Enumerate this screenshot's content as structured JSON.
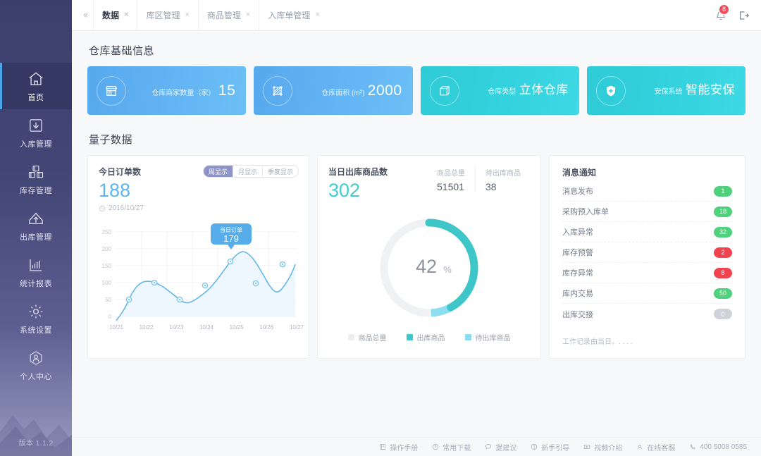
{
  "sidebar": {
    "version": "版本 1.1.2",
    "items": [
      {
        "label": "首页",
        "icon": "home-icon",
        "active": true
      },
      {
        "label": "入库管理",
        "icon": "inbound-arrow-icon",
        "active": false
      },
      {
        "label": "库存管理",
        "icon": "boxes-icon",
        "active": false
      },
      {
        "label": "出库管理",
        "icon": "outbound-arrow-icon",
        "active": false
      },
      {
        "label": "统计报表",
        "icon": "bar-chart-icon",
        "active": false
      },
      {
        "label": "系统设置",
        "icon": "gear-icon",
        "active": false
      },
      {
        "label": "个人中心",
        "icon": "user-hex-icon",
        "active": false
      }
    ]
  },
  "tabbar": {
    "collapse_icon": "collapse-left-icon",
    "tabs": [
      {
        "label": "数据",
        "active": true,
        "close": "×"
      },
      {
        "label": "库区管理",
        "active": false,
        "close": "×"
      },
      {
        "label": "商品管理",
        "active": false,
        "close": "×"
      },
      {
        "label": "入库单管理",
        "active": false,
        "close": "×"
      }
    ],
    "notification_icon": "bell-icon",
    "notification_count": "8",
    "logout_icon": "logout-icon"
  },
  "basic_info": {
    "title": "仓库基础信息",
    "cards": [
      {
        "label": "仓库商家数量（家）",
        "value": "15",
        "icon": "store-icon",
        "theme": "blue",
        "is_word": false
      },
      {
        "label": "仓库面积 (m²)",
        "value": "2000",
        "icon": "area-hatch-icon",
        "theme": "blue",
        "is_word": false
      },
      {
        "label": "仓库类型",
        "value": "立体仓库",
        "icon": "cube-icon",
        "theme": "cyan",
        "is_word": true
      },
      {
        "label": "安保系统",
        "value": "智能安保",
        "icon": "shield-icon",
        "theme": "cyan",
        "is_word": true
      }
    ]
  },
  "quantum": {
    "title": "量子数据",
    "orders_panel": {
      "title": "今日订单数",
      "value": "188",
      "date": "2016/10/27",
      "clock_icon": "clock-icon",
      "segments": [
        {
          "label": "周显示",
          "active": true
        },
        {
          "label": "月显示",
          "active": false
        },
        {
          "label": "季度显示",
          "active": false
        }
      ],
      "tooltip": {
        "title": "当日订单",
        "value": "179"
      }
    },
    "outbound_panel": {
      "title": "当日出库商品数",
      "value": "302",
      "stats": [
        {
          "label": "商品总量",
          "value": "51501"
        },
        {
          "label": "待出库商品",
          "value": "38"
        }
      ],
      "donut_center": "42",
      "donut_unit": "%",
      "legend": [
        {
          "label": "商品总量",
          "color": "#eceef0"
        },
        {
          "label": "出库商品",
          "color": "#3ec6c8"
        },
        {
          "label": "待出库商品",
          "color": "#8ddcf0"
        }
      ]
    },
    "notifications": {
      "title": "消息通知",
      "items": [
        {
          "label": "消息发布",
          "count": "1",
          "type": "green"
        },
        {
          "label": "采购预入库单",
          "count": "18",
          "type": "green"
        },
        {
          "label": "入库异常",
          "count": "32",
          "type": "green"
        },
        {
          "label": "库存预警",
          "count": "2",
          "type": "red"
        },
        {
          "label": "库存异常",
          "count": "8",
          "type": "red"
        },
        {
          "label": "库内交易",
          "count": "50",
          "type": "green"
        },
        {
          "label": "出库交接",
          "count": "0",
          "type": "grey"
        }
      ],
      "footnote": "工作记录由当日。. . . ."
    }
  },
  "footer": {
    "items": [
      {
        "label": "操作手册",
        "icon": "book-icon"
      },
      {
        "label": "常用下载",
        "icon": "download-icon"
      },
      {
        "label": "提建议",
        "icon": "comment-icon"
      },
      {
        "label": "新手引导",
        "icon": "question-icon"
      },
      {
        "label": "视频介绍",
        "icon": "video-icon"
      },
      {
        "label": "在线客服",
        "icon": "headset-icon"
      },
      {
        "label": "400 5008 0585",
        "icon": "phone-icon"
      }
    ]
  },
  "chart_data": {
    "type": "line",
    "title": "今日订单数",
    "x": [
      "10/21",
      "10/22",
      "10/23",
      "10/24",
      "10/25",
      "10/26",
      "10/27"
    ],
    "point_x_offsets": [
      0.5,
      1.5,
      2.5,
      3.5,
      4.5,
      5.5,
      6.5
    ],
    "values": [
      58,
      116,
      60,
      105,
      182,
      115,
      173
    ],
    "ylim": [
      0,
      250
    ],
    "yticks": [
      0,
      50,
      100,
      150,
      200,
      250
    ],
    "xlabel": "",
    "ylabel": "",
    "grid": true,
    "legend": "none",
    "line_color": "#63b8e8",
    "area_color": "#eaf6fd",
    "annotation": {
      "label": "当日订单",
      "value": "179",
      "at_index": 4
    }
  },
  "donut_data": {
    "type": "pie",
    "title": "当日出库商品数",
    "center_label": "42%",
    "series": [
      {
        "name": "出库商品",
        "value": 42,
        "color": "#3ec6c8"
      },
      {
        "name": "待出库商品",
        "value": 5,
        "color": "#8ddcf0"
      },
      {
        "name": "商品总量",
        "value": 53,
        "color": "#eceef0"
      }
    ]
  },
  "colors": {
    "brand_blue": "#5eb4ee",
    "brand_cyan": "#3fcfce",
    "sidebar": "#3d3f6b",
    "accent_purple": "#8e93c8",
    "danger": "#f0424f",
    "success": "#4fd07b"
  }
}
